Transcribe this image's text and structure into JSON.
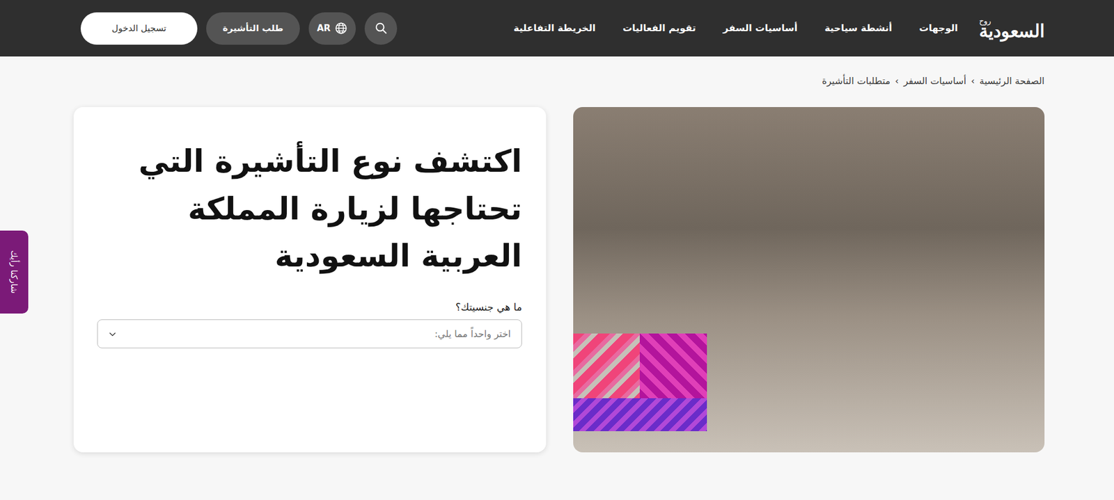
{
  "logo": {
    "prefix": "روح",
    "name": "السعودية"
  },
  "nav": {
    "items": [
      {
        "label": "الوجهات"
      },
      {
        "label": "أنشطة سياحية"
      },
      {
        "label": "أساسيات السفر"
      },
      {
        "label": "تقويم الفعاليات"
      },
      {
        "label": "الخريطة التفاعلية"
      }
    ]
  },
  "actions": {
    "language": "AR",
    "visa_button": "طلب التأشيرة",
    "login_button": "تسجيل الدخول"
  },
  "breadcrumb": {
    "separator": "›",
    "items": [
      {
        "label": "الصفحة الرئيسية"
      },
      {
        "label": "أساسيات السفر"
      },
      {
        "label": "متطلبات التأشيرة"
      }
    ]
  },
  "hero": {
    "title": "اكتشف نوع التأشيرة التي تحتاجها لزيارة المملكة العربية السعودية",
    "nationality": {
      "label": "ما هي جنسيتك؟",
      "placeholder": "اختر واحداً مما يلي:"
    }
  },
  "feedback_tab": {
    "label": "شاركنا رأيك"
  }
}
